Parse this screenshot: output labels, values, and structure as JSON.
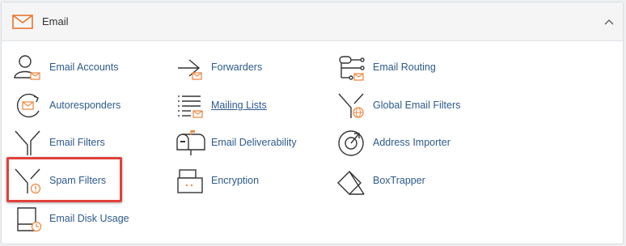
{
  "section": {
    "title": "Email"
  },
  "colors": {
    "accent": "#f08a45",
    "link": "#2d5a8c",
    "icon": "#333333",
    "highlight": "#e0413c"
  },
  "items": [
    {
      "label": "Email Accounts",
      "icon": "user-mail-icon"
    },
    {
      "label": "Forwarders",
      "icon": "forward-arrow-icon"
    },
    {
      "label": "Email Routing",
      "icon": "routing-icon"
    },
    {
      "label": "Autoresponders",
      "icon": "autoresponder-icon"
    },
    {
      "label": "Mailing Lists",
      "icon": "list-mail-icon"
    },
    {
      "label": "Global Email Filters",
      "icon": "funnel-globe-icon"
    },
    {
      "label": "Email Filters",
      "icon": "funnel-icon"
    },
    {
      "label": "Email Deliverability",
      "icon": "mailbox-icon"
    },
    {
      "label": "Address Importer",
      "icon": "importer-icon"
    },
    {
      "label": "Spam Filters",
      "icon": "funnel-warning-icon"
    },
    {
      "label": "Encryption",
      "icon": "encryption-icon"
    },
    {
      "label": "BoxTrapper",
      "icon": "box-trap-icon"
    },
    {
      "label": "Email Disk Usage",
      "icon": "disk-usage-icon"
    }
  ]
}
